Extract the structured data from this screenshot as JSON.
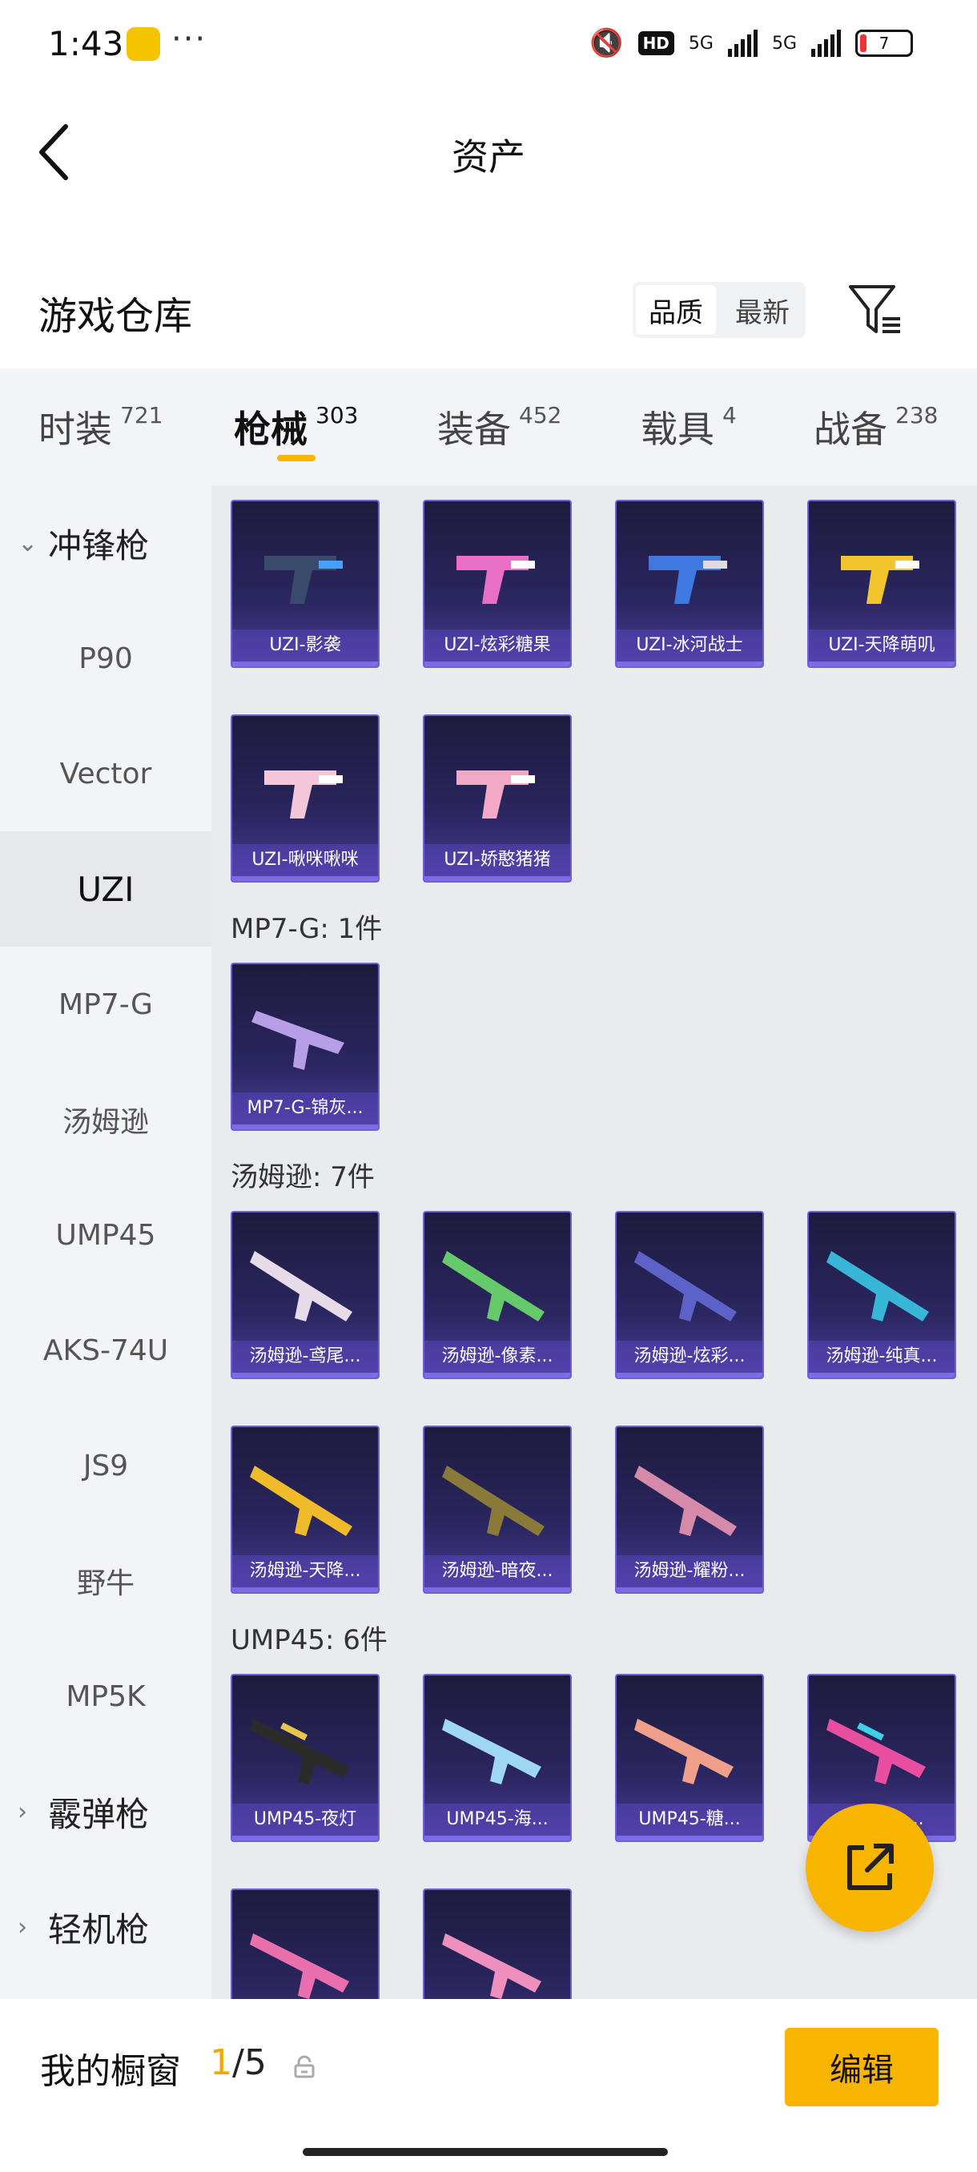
{
  "status_bar": {
    "time": "1:43",
    "dots": "···",
    "hd": "HD",
    "sig1": "5G",
    "sig2": "5G",
    "battery": "7"
  },
  "header": {
    "title": "资产"
  },
  "warehouse": {
    "title": "游戏仓库",
    "sort_quality": "品质",
    "sort_newest": "最新"
  },
  "tabs": [
    {
      "label": "时装",
      "count": "721"
    },
    {
      "label": "枪械",
      "count": "303"
    },
    {
      "label": "装备",
      "count": "452"
    },
    {
      "label": "载具",
      "count": "4"
    },
    {
      "label": "战备",
      "count": "238"
    }
  ],
  "sidebar": {
    "group_smg": "冲锋枪",
    "items": [
      "P90",
      "Vector",
      "UZI",
      "MP7-G",
      "汤姆逊",
      "UMP45",
      "AKS-74U",
      "JS9",
      "野牛",
      "MP5K"
    ],
    "group_shotgun": "霰弹枪",
    "group_lmg": "轻机枪"
  },
  "sections": {
    "mp7": "MP7-G: 1件",
    "thompson": "汤姆逊: 7件",
    "ump": "UMP45: 6件"
  },
  "cards": {
    "uzi": [
      "UZI-影袭",
      "UZI-炫彩糖果",
      "UZI-冰河战士",
      "UZI-天降萌叽",
      "UZI-啾咪啾咪",
      "UZI-娇憨猪猪"
    ],
    "mp7": [
      "MP7-G-锦灰..."
    ],
    "thompson": [
      "汤姆逊-鸢尾...",
      "汤姆逊-像素...",
      "汤姆逊-炫彩...",
      "汤姆逊-纯真...",
      "汤姆逊-天降...",
      "汤姆逊-暗夜...",
      "汤姆逊-耀粉..."
    ],
    "ump": [
      "UMP45-夜灯",
      "UMP45-海...",
      "UMP45-糖...",
      "UMP45-..."
    ]
  },
  "bottom": {
    "showcase_label": "我的橱窗",
    "current": "1",
    "total": "/5",
    "edit_label": "编辑"
  },
  "colors": {
    "accent": "#f7b500",
    "card_bg": "#2a2660",
    "card_border": "#6d5fd6"
  }
}
